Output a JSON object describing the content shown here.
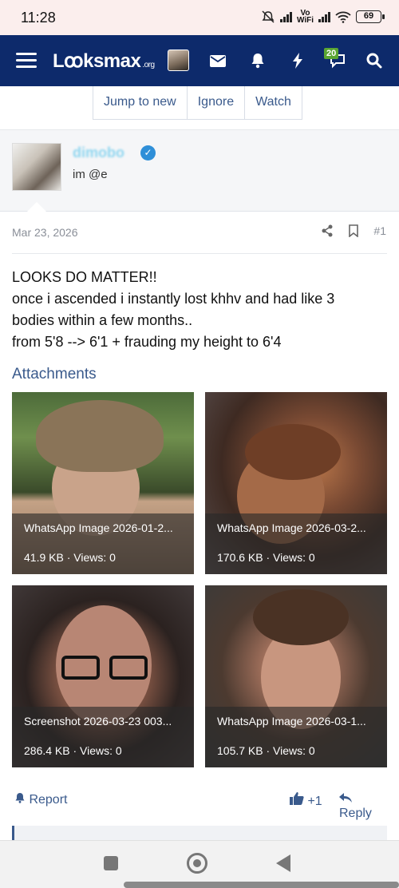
{
  "status_bar": {
    "time": "11:28",
    "battery": "69",
    "vo_top": "Vo",
    "vo_bottom": "WiFi"
  },
  "nav": {
    "logo": "Lꝏksmax",
    "logo_suffix": ".org",
    "notification_count": "20"
  },
  "thread_actions": [
    "Jump to new",
    "Ignore",
    "Watch"
  ],
  "user": {
    "name": "dimobo",
    "title": "im @e",
    "verified": true
  },
  "post": {
    "date": "Mar 23, 2026",
    "number": "#1",
    "lines": [
      "LOOKS DO MATTER!!",
      "once i ascended i instantly lost khhv and had like 3",
      "bodies within a few months..",
      "from 5'8 --> 6'1 + frauding my height to 6'4"
    ]
  },
  "attachments": {
    "title": "Attachments",
    "items": [
      {
        "name": "WhatsApp Image 2026-01-2...",
        "meta": "41.9 KB · Views: 0"
      },
      {
        "name": "WhatsApp Image 2026-03-2...",
        "meta": "170.6 KB · Views: 0"
      },
      {
        "name": "Screenshot 2026-03-23 003...",
        "meta": "286.4 KB · Views: 0"
      },
      {
        "name": "WhatsApp Image 2026-03-1...",
        "meta": "105.7 KB · Views: 0"
      }
    ]
  },
  "footer": {
    "report": "Report",
    "like": "+1",
    "reply": "Reply"
  },
  "colors": {
    "nav_bg": "#0d2a6b",
    "link": "#3a5a8c",
    "badge": "#5aa532",
    "verified": "#2f8fd8"
  }
}
